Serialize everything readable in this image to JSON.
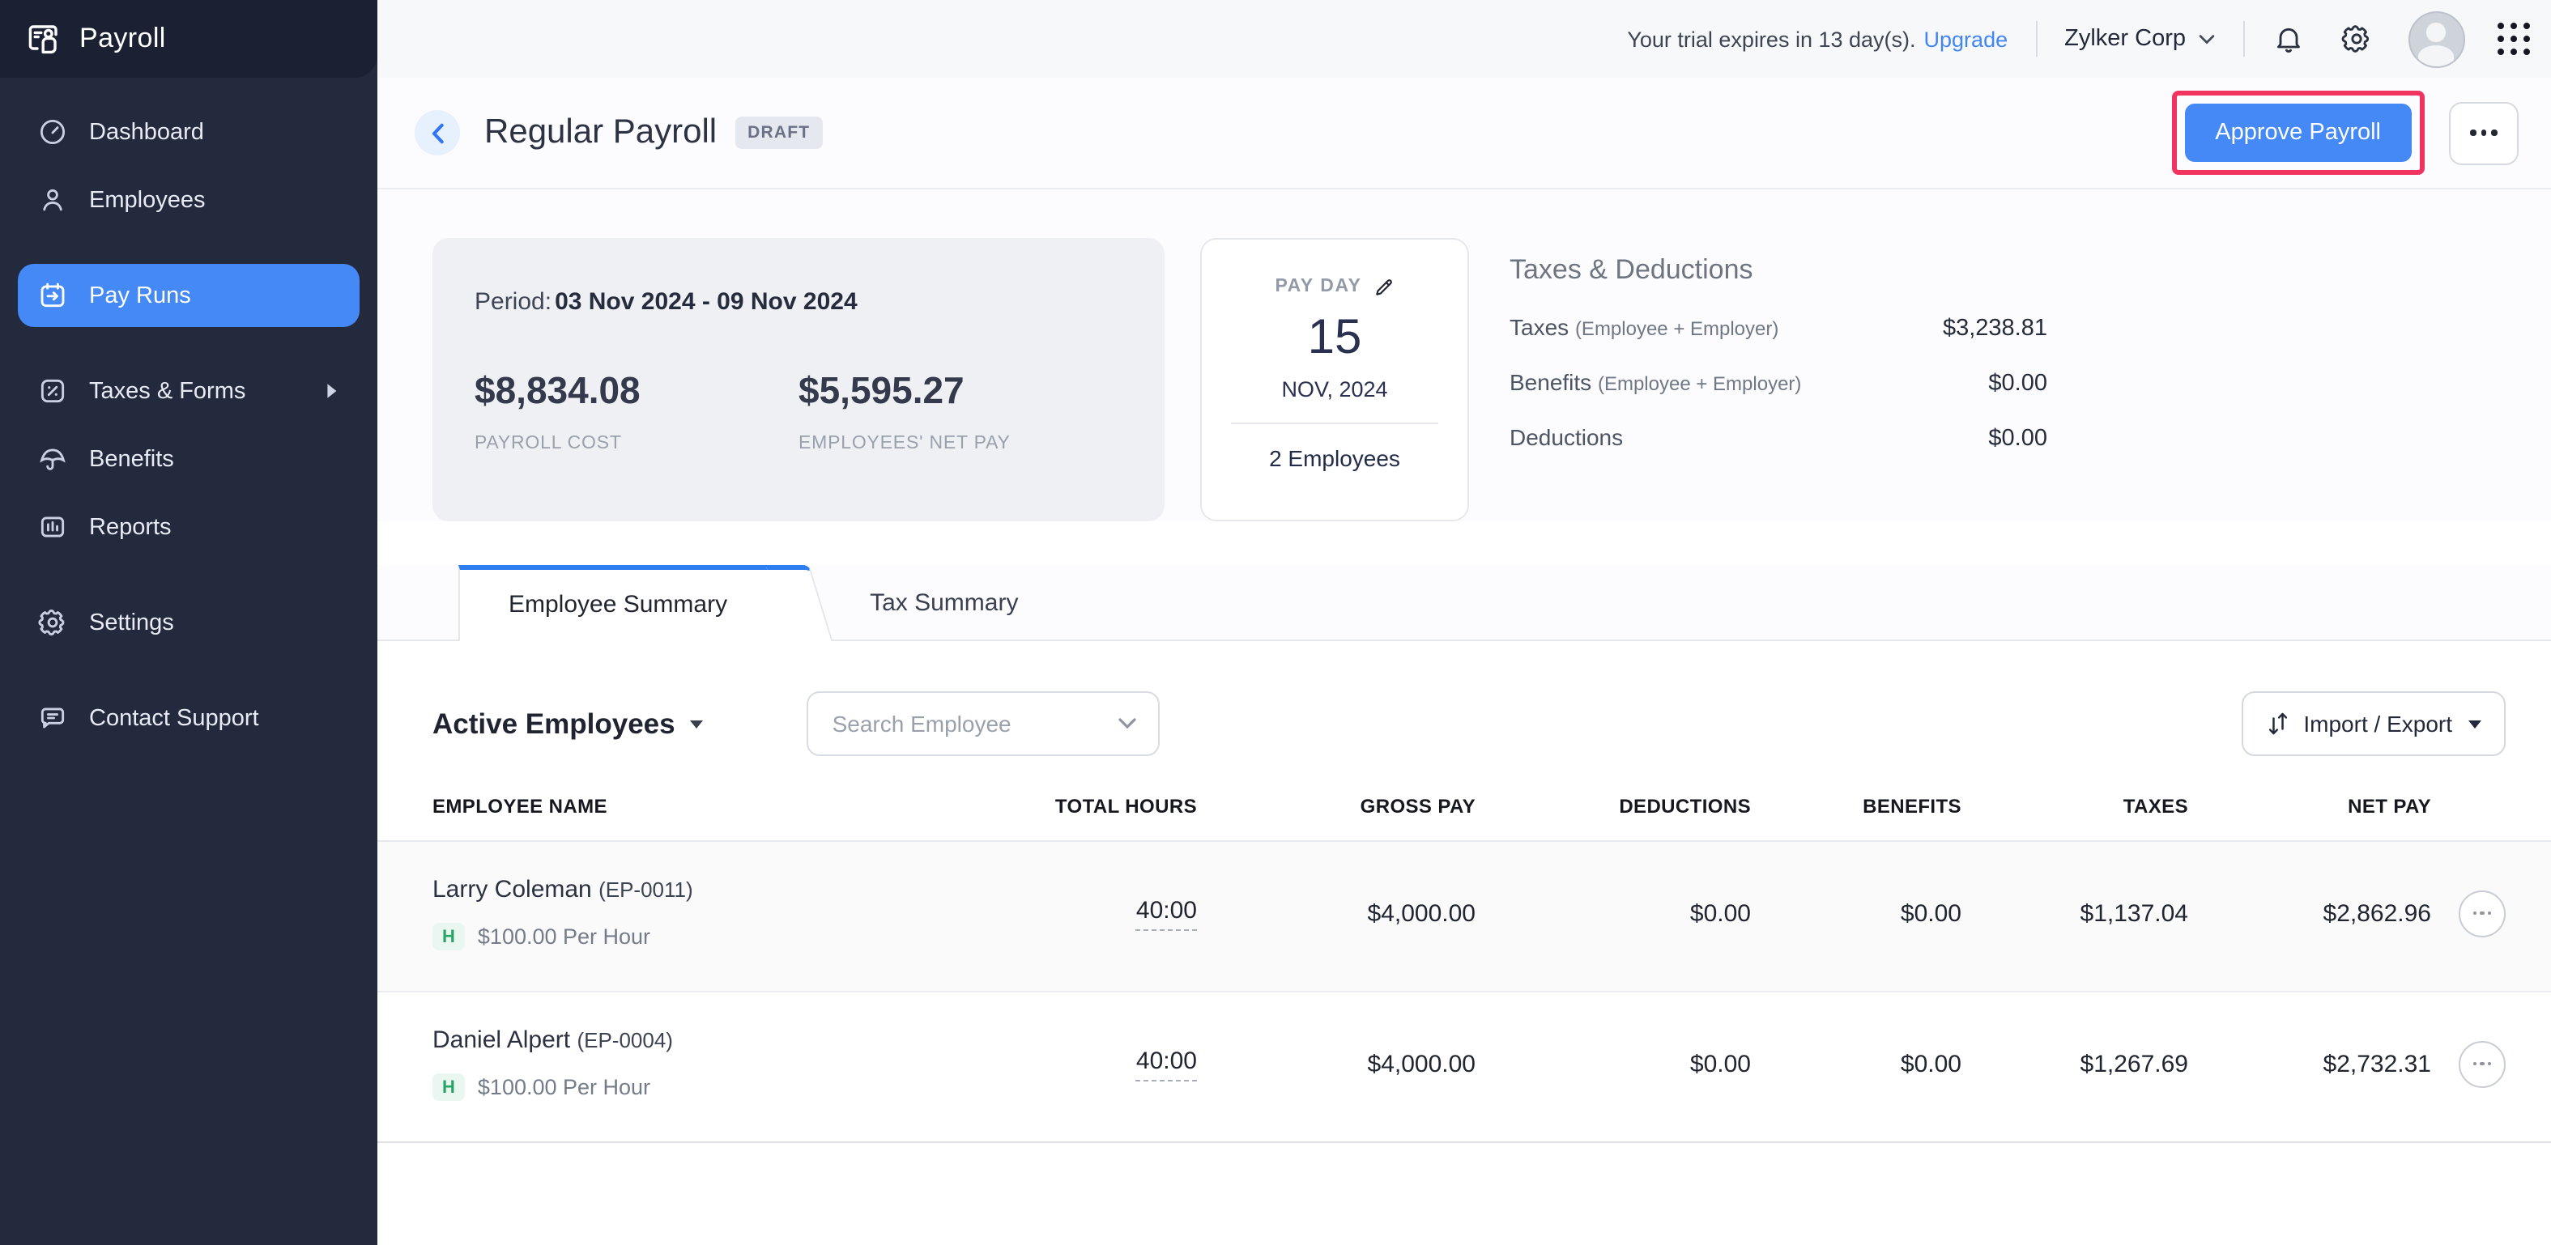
{
  "brand": {
    "app_name": "Payroll"
  },
  "sidebar": {
    "items": [
      {
        "label": "Dashboard"
      },
      {
        "label": "Employees"
      },
      {
        "label": "Pay Runs",
        "active": true
      },
      {
        "label": "Taxes & Forms",
        "has_submenu": true
      },
      {
        "label": "Benefits"
      },
      {
        "label": "Reports"
      },
      {
        "label": "Settings"
      },
      {
        "label": "Contact Support"
      }
    ]
  },
  "topbar": {
    "trial_text": "Your trial expires in 13 day(s).",
    "upgrade_label": "Upgrade",
    "org_name": "Zylker Corp"
  },
  "header": {
    "title": "Regular Payroll",
    "badge": "DRAFT",
    "approve_label": "Approve Payroll"
  },
  "summary": {
    "period_label": "Period:",
    "period_value": "03 Nov 2024 - 09 Nov 2024",
    "payroll_cost": {
      "value": "$8,834.08",
      "label": "PAYROLL COST"
    },
    "net_pay": {
      "value": "$5,595.27",
      "label": "EMPLOYEES' NET PAY"
    },
    "pay_day": {
      "label": "PAY DAY",
      "day": "15",
      "month_year": "NOV, 2024",
      "employees_count": "2 Employees"
    },
    "taxes_deductions": {
      "title": "Taxes & Deductions",
      "rows": [
        {
          "label": "Taxes",
          "sub": "(Employee + Employer)",
          "value": "$3,238.81"
        },
        {
          "label": "Benefits",
          "sub": "(Employee + Employer)",
          "value": "$0.00"
        },
        {
          "label": "Deductions",
          "sub": "",
          "value": "$0.00"
        }
      ]
    }
  },
  "tabs": [
    {
      "label": "Employee Summary",
      "active": true
    },
    {
      "label": "Tax Summary",
      "active": false
    }
  ],
  "toolbar": {
    "filter_label": "Active Employees",
    "search_placeholder": "Search Employee",
    "import_export_label": "Import / Export"
  },
  "table": {
    "columns": [
      "EMPLOYEE NAME",
      "TOTAL HOURS",
      "GROSS PAY",
      "DEDUCTIONS",
      "BENEFITS",
      "TAXES",
      "NET PAY"
    ],
    "rows": [
      {
        "name": "Larry Coleman",
        "emp_id": "(EP-0011)",
        "pay_type_badge": "H",
        "rate": "$100.00 Per Hour",
        "hours": "40:00",
        "gross": "$4,000.00",
        "deductions": "$0.00",
        "benefits": "$0.00",
        "taxes": "$1,137.04",
        "net": "$2,862.96"
      },
      {
        "name": "Daniel Alpert",
        "emp_id": "(EP-0004)",
        "pay_type_badge": "H",
        "rate": "$100.00 Per Hour",
        "hours": "40:00",
        "gross": "$4,000.00",
        "deductions": "$0.00",
        "benefits": "$0.00",
        "taxes": "$1,267.69",
        "net": "$2,732.31"
      }
    ]
  },
  "colors": {
    "accent_blue": "#4489f6",
    "annotation_red": "#f0335f",
    "sidebar_bg": "#242a3e",
    "badge_green": "#27a566",
    "topbar_bg": "#f7f8fa"
  }
}
